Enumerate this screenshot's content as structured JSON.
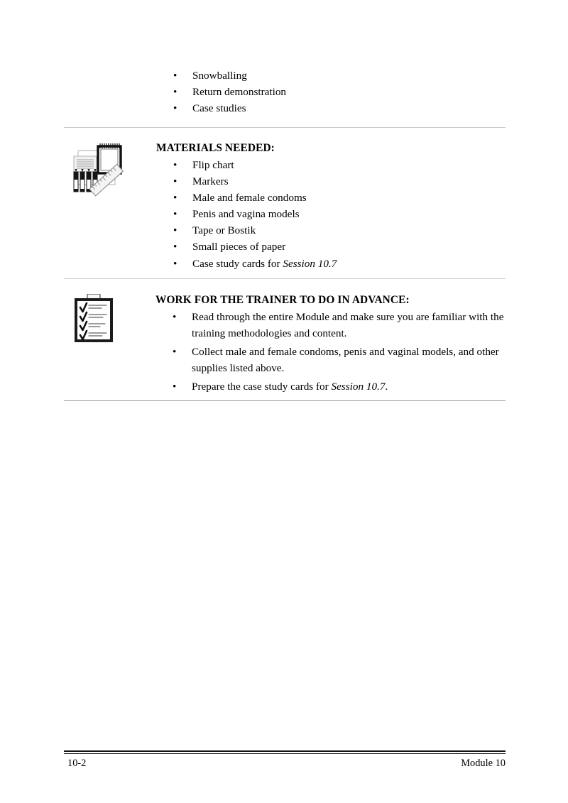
{
  "document": {
    "page_label": "10-2",
    "module_label": "Module 10",
    "background_color": "#ffffff",
    "text_color": "#000000",
    "rule_color": "#c8c8c8"
  },
  "methods_list": {
    "items": [
      "Snowballing",
      "Return demonstration",
      "Case studies"
    ]
  },
  "materials_section": {
    "icon": "flipchart-markers-ruler-icon",
    "heading": "MATERIALS NEEDED:",
    "items": [
      {
        "text": "Flip chart"
      },
      {
        "text": "Markers"
      },
      {
        "text": "Male and female condoms"
      },
      {
        "text": "Penis and vagina models"
      },
      {
        "text": "Tape or Bostik"
      },
      {
        "text": "Small pieces of paper"
      },
      {
        "text": "Case study cards for ",
        "italic": "Session 10.7",
        "tail": ""
      }
    ]
  },
  "trainer_section": {
    "icon": "clipboard-checklist-icon",
    "heading": "WORK FOR THE TRAINER TO DO IN ADVANCE:",
    "items": [
      {
        "text": "Read through the entire Module and make sure you are familiar with the training methodologies and content."
      },
      {
        "text": "Collect male and female condoms, penis and vaginal models, and other supplies listed above."
      },
      {
        "text": "Prepare the case study cards for ",
        "italic": "Session 10.7",
        "tail": "."
      }
    ]
  }
}
